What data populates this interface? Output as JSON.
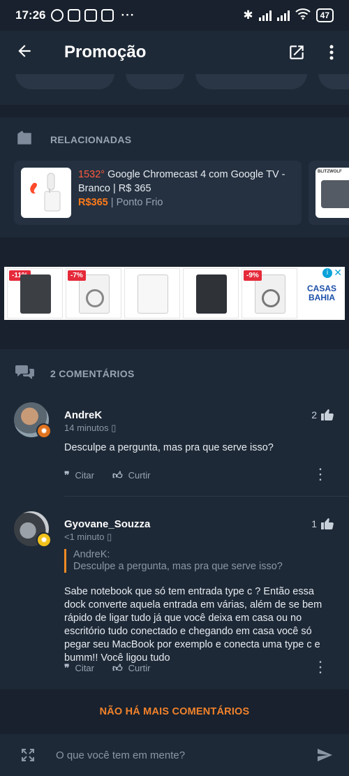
{
  "status_bar": {
    "time": "17:26",
    "more": "···",
    "battery": "47"
  },
  "app_bar": {
    "title": "Promoção"
  },
  "related": {
    "heading": "RELACIONADAS",
    "card": {
      "hot_count": "1532°",
      "title": " Google Chromecast 4 com Google TV - Branco | R$ 365",
      "price": "R$365",
      "separator": " | ",
      "store": "Ponto Frio"
    },
    "card2_logo": "BLITZWOLF"
  },
  "ad": {
    "items": [
      {
        "tag": "-11%",
        "washer_color": "#3c3f44"
      },
      {
        "tag": "-7%",
        "washer_color": "#f2f2f2"
      },
      {
        "tag": "",
        "washer_color": "#f7f7f7"
      },
      {
        "tag": "",
        "washer_color": "#2f3237"
      },
      {
        "tag": "-9%",
        "washer_color": "#f0f0f0"
      }
    ],
    "brand": "CASAS BAHIA",
    "info": "i",
    "close": "✕"
  },
  "comments": {
    "heading": "2 COMENTÁRIOS",
    "list": [
      {
        "author": "AndreK",
        "time": "14 minutos",
        "likes": "2",
        "text": "Desculpe a pergunta, mas pra que serve isso?",
        "cite": "Citar",
        "like": "Curtir"
      },
      {
        "author": "Gyovane_Souzza",
        "time": "<1 minuto",
        "likes": "1",
        "quote_author": "AndreK:",
        "quote_text": "Desculpe a pergunta, mas pra que serve isso?",
        "text": "Sabe notebook que só tem entrada type c ? Então essa dock converte aquela entrada em várias, além de se bem rápido de ligar tudo já que você deixa em casa ou no escritório tudo conectado e chegando em casa você só pegar seu MacBook por exemplo e conecta uma type c e bumm!! Você ligou tudo",
        "cite": "Citar",
        "like": "Curtir"
      }
    ]
  },
  "no_more": "NÃO HÁ MAIS COMENTÁRIOS",
  "composer": {
    "placeholder": "O que você tem em mente?"
  },
  "colors": {
    "accent": "#f2822c",
    "hot": "#ff5a3c",
    "background": "#18212d",
    "card": "#1e2937"
  }
}
